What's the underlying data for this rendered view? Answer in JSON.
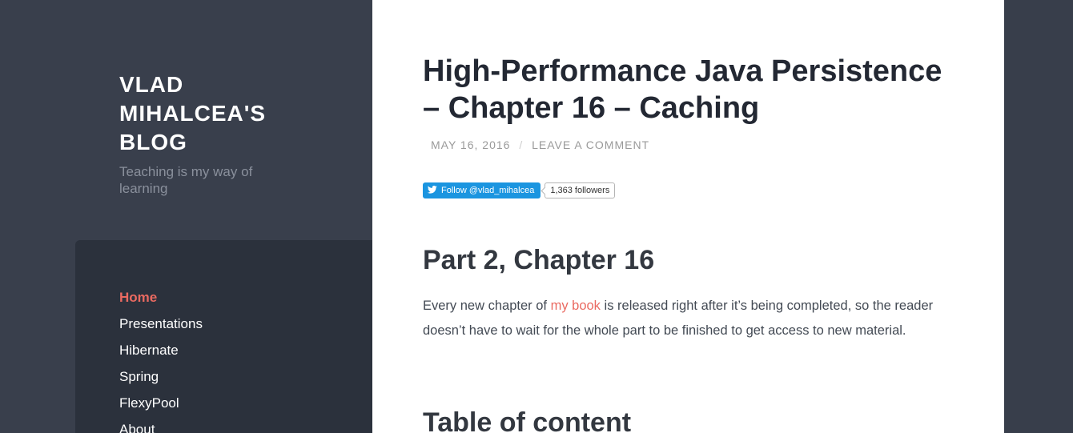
{
  "site": {
    "title": "VLAD MIHALCEA'S BLOG",
    "tagline": "Teaching is my way of learning"
  },
  "nav": {
    "items": [
      {
        "label": "Home",
        "active": true
      },
      {
        "label": "Presentations",
        "active": false
      },
      {
        "label": "Hibernate",
        "active": false
      },
      {
        "label": "Spring",
        "active": false
      },
      {
        "label": "FlexyPool",
        "active": false
      },
      {
        "label": "About",
        "active": false
      }
    ]
  },
  "post": {
    "title": "High-Performance Java Persistence – Chapter 16 – Caching",
    "date": "MAY 16, 2016",
    "meta_separator": "/",
    "comment_link": "LEAVE A COMMENT",
    "twitter": {
      "follow_label": "Follow @vlad_mihalcea",
      "followers": "1,363 followers"
    },
    "section1_heading": "Part 2, Chapter 16",
    "paragraph": {
      "before_link": "Every new chapter of ",
      "link_text": "my book",
      "after_link": " is released right after it’s being completed, so the reader doesn’t have to wait for the whole part to be finished to get access to new material."
    },
    "section2_heading": "Table of content"
  },
  "colors": {
    "accent": "#ea6a61",
    "sidebar_bg": "#393f4c",
    "nav_panel_bg": "#2b313c",
    "twitter_blue": "#1b95e0"
  }
}
